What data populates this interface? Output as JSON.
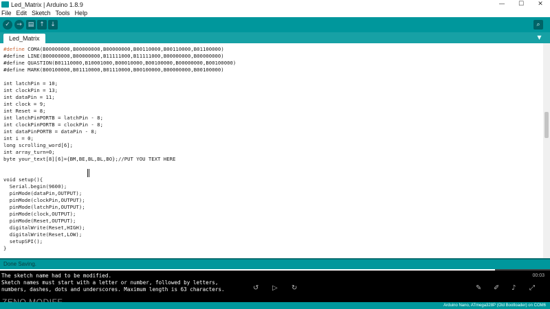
{
  "window": {
    "title": "Led_Matrix | Arduino 1.8.9",
    "minimize": "—",
    "maximize": "☐",
    "close": "✕"
  },
  "menu": [
    "File",
    "Edit",
    "Sketch",
    "Tools",
    "Help"
  ],
  "toolbar": {
    "verify_icon": "✓",
    "upload_icon": "→",
    "new_icon": "▤",
    "open_icon": "↑",
    "save_icon": "↓",
    "serial_icon": "⌕"
  },
  "tab": {
    "name": "Led_Matrix",
    "menu_icon": "▼"
  },
  "code": [
    "#define COMA(B00000000,B00000000,B00000000,B00110000,B00110000,B01100000)",
    "#define LINE(B00000000,B00000000,B11111000,B11111000,B00000000,B00000000)",
    "#define QUASTION(B01110000,B10001000,B00010000,B00100000,B00000000,B00100000)",
    "#define MARK(B00100000,B01110000,B01110000,B00100000,B00000000,B00100000)",
    "",
    "int latchPin = 10;",
    "int clockPin = 13;",
    "int dataPin = 11;",
    "int clock = 9;",
    "int Reset = 8;",
    "int latchPinPORTB = latchPin - 8;",
    "int clockPinPORTB = clockPin - 8;",
    "int dataPinPORTB = dataPin - 8;",
    "int i = 0;",
    "long scrolling_word[6];",
    "int array_turn=0;",
    "byte your_text[8][6]={BM,BE,BL,BL,BO};//PUT YOU TEXT HERE",
    "",
    "",
    "void setup(){",
    "  Serial.begin(9600);",
    "  pinMode(dataPin,OUTPUT);",
    "  pinMode(clockPin,OUTPUT);",
    "  pinMode(latchPin,OUTPUT);",
    "  pinMode(clock,OUTPUT);",
    "  pinMode(Reset,OUTPUT);",
    "  digitalWrite(Reset,HIGH);",
    "  digitalWrite(Reset,LOW);",
    "  setupSPI();",
    "}"
  ],
  "status": {
    "text": "Done Saving."
  },
  "console": [
    "The sketch name had to be modified.",
    "Sketch names must start with a letter or number, followed by letters,",
    "numbers, dashes, dots and underscores. Maximum length is 63 characters."
  ],
  "board": "Arduino Nano, ATmega328P (Old Bootloader) on COM6",
  "watermark": "ZENO MODIFF",
  "player": {
    "progress": 0.9,
    "time": "00:03",
    "rewind_icon": "↺",
    "play_icon": "▷",
    "forward_icon": "↻",
    "pen_icon": "✎",
    "edit_icon": "✐",
    "volume_icon": "♪",
    "fullscreen_icon": "⤢"
  }
}
